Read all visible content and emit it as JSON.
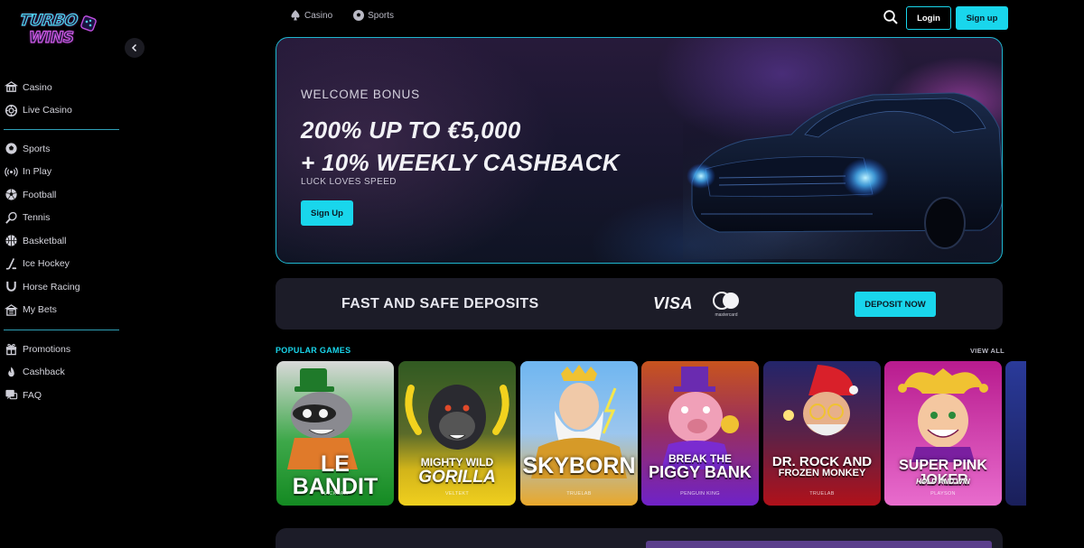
{
  "brand": {
    "logo_line1": "TURBO",
    "logo_line2": "WINS"
  },
  "sidebar": {
    "group1": [
      {
        "label": "Casino",
        "icon": "casino-icon"
      },
      {
        "label": "Live Casino",
        "icon": "live-casino-icon"
      }
    ],
    "group2": [
      {
        "label": "Sports",
        "icon": "sports-icon"
      },
      {
        "label": "In Play",
        "icon": "in-play-icon"
      },
      {
        "label": "Football",
        "icon": "football-icon"
      },
      {
        "label": "Tennis",
        "icon": "tennis-icon"
      },
      {
        "label": "Basketball",
        "icon": "basketball-icon"
      },
      {
        "label": "Ice Hockey",
        "icon": "ice-hockey-icon"
      },
      {
        "label": "Horse Racing",
        "icon": "horse-racing-icon"
      },
      {
        "label": "My Bets",
        "icon": "my-bets-icon"
      }
    ],
    "group3": [
      {
        "label": "Promotions",
        "icon": "gift-icon"
      },
      {
        "label": "Cashback",
        "icon": "flame-icon"
      },
      {
        "label": "FAQ",
        "icon": "faq-icon"
      }
    ]
  },
  "topnav": {
    "items": [
      {
        "label": "Casino",
        "icon": "spade-icon"
      },
      {
        "label": "Sports",
        "icon": "soccer-ball-icon"
      }
    ],
    "login_label": "Login",
    "signup_label": "Sign up"
  },
  "hero": {
    "kicker": "WELCOME BONUS",
    "headline_line1": "200% UP TO €5,000",
    "headline_line2": "+ 10% WEEKLY CASHBACK",
    "tagline": "LUCK LOVES SPEED",
    "cta_label": "Sign Up"
  },
  "deposit": {
    "title": "FAST AND SAFE DEPOSITS",
    "visa_label": "VISA",
    "mastercard_label": "mastercard",
    "cta_label": "DEPOSIT NOW"
  },
  "popular": {
    "title": "POPULAR GAMES",
    "view_all_label": "VIEW ALL",
    "games": [
      {
        "line1": "LE BANDIT",
        "line2": "",
        "provider": "HACKSAW",
        "bg_top": "#2f9a3b",
        "bg_bottom": "#13831f"
      },
      {
        "line1": "MIGHTY WILD",
        "line2": "GORILLA",
        "provider": "VELTEKT",
        "bg_top": "#2b4a1a",
        "bg_bottom": "#e7c51b"
      },
      {
        "line1": "SKYBORN",
        "line2": "",
        "provider": "TRUELAB",
        "bg_top": "#4a8ee0",
        "bg_bottom": "#e9a82a"
      },
      {
        "line1": "BREAK THE",
        "line2": "PIGGY BANK",
        "provider": "PENGUIN KING",
        "bg_top": "#c75a1e",
        "bg_bottom": "#7a24c9"
      },
      {
        "line1": "DR. ROCK AND",
        "line2": "FROZEN MONKEY",
        "provider": "TRUELAB",
        "bg_top": "#2b2c7a",
        "bg_bottom": "#b1121a"
      },
      {
        "line1": "SUPER PINK JOKER",
        "line2": "HOLD AND WIN",
        "provider": "PLAYSON",
        "bg_top": "#c81e96",
        "bg_bottom": "#e55ac7"
      }
    ]
  },
  "colors": {
    "accent": "#19d6ec",
    "panel": "#1c1c28",
    "background": "#000000"
  }
}
